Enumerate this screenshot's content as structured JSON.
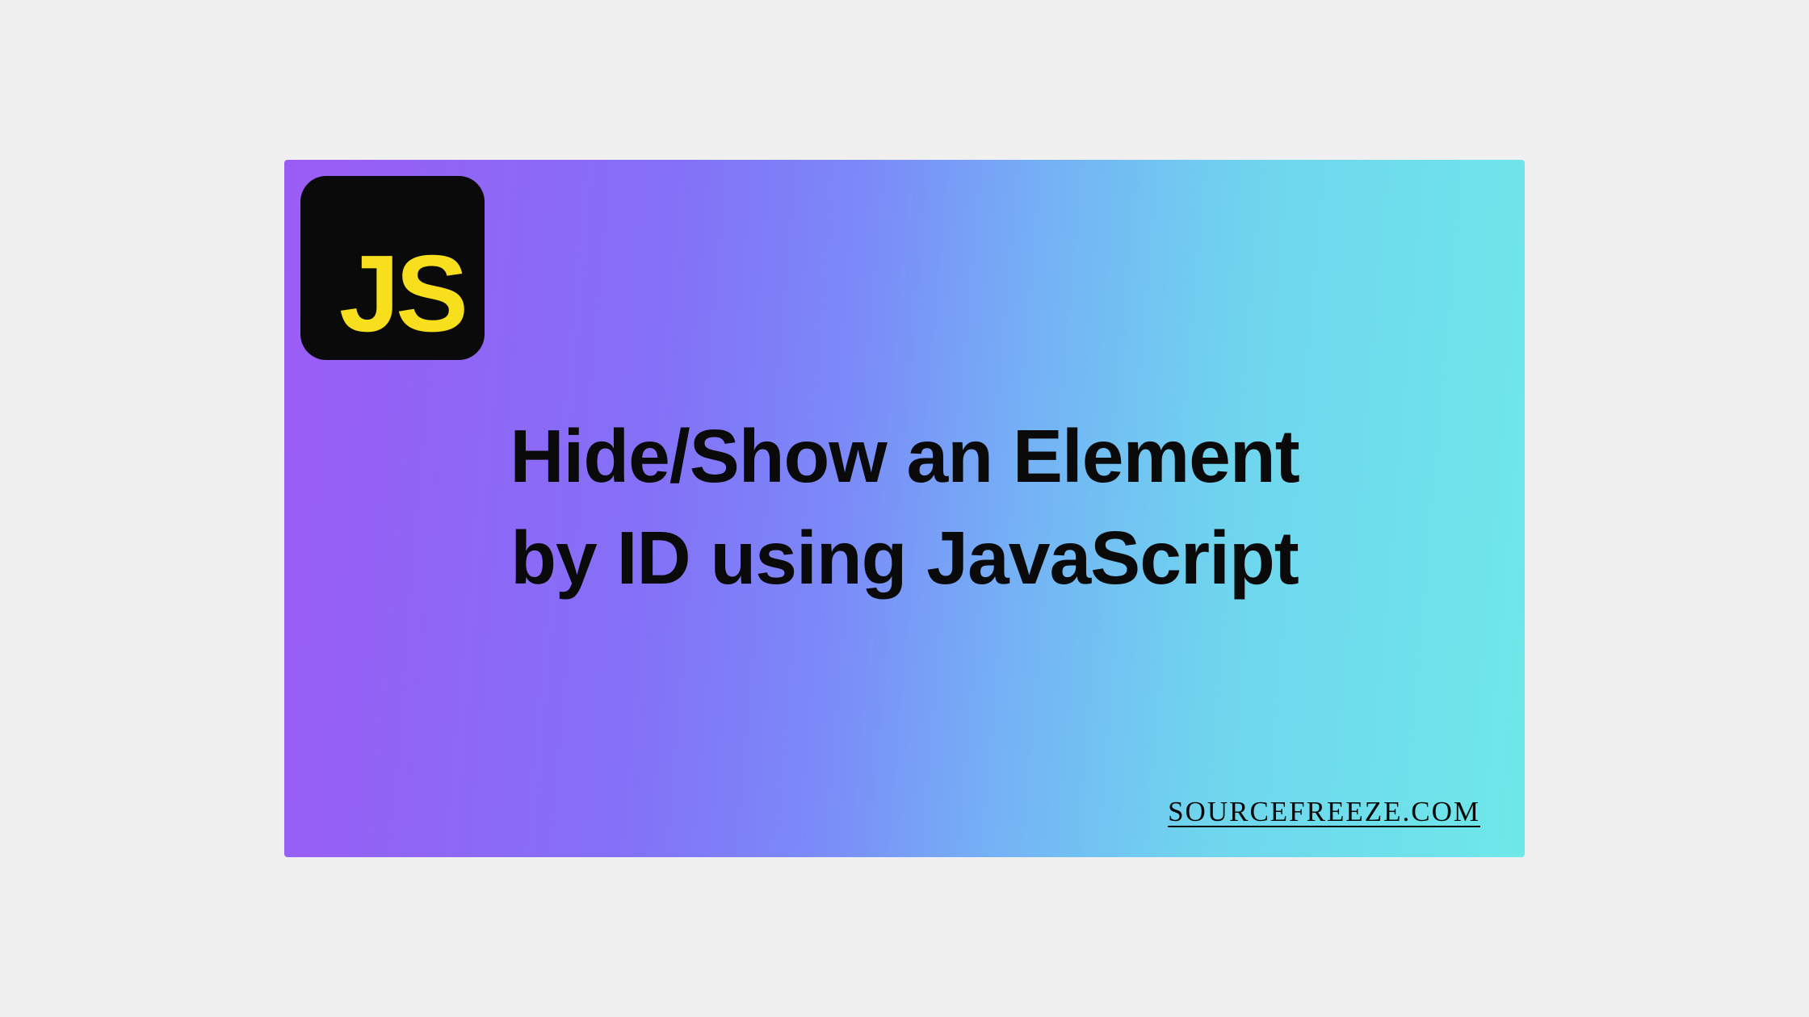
{
  "logo": {
    "text": "JS"
  },
  "title": {
    "line1": "Hide/Show an Element",
    "line2": "by ID using JavaScript"
  },
  "attribution": "SOURCEFREEZE.COM"
}
